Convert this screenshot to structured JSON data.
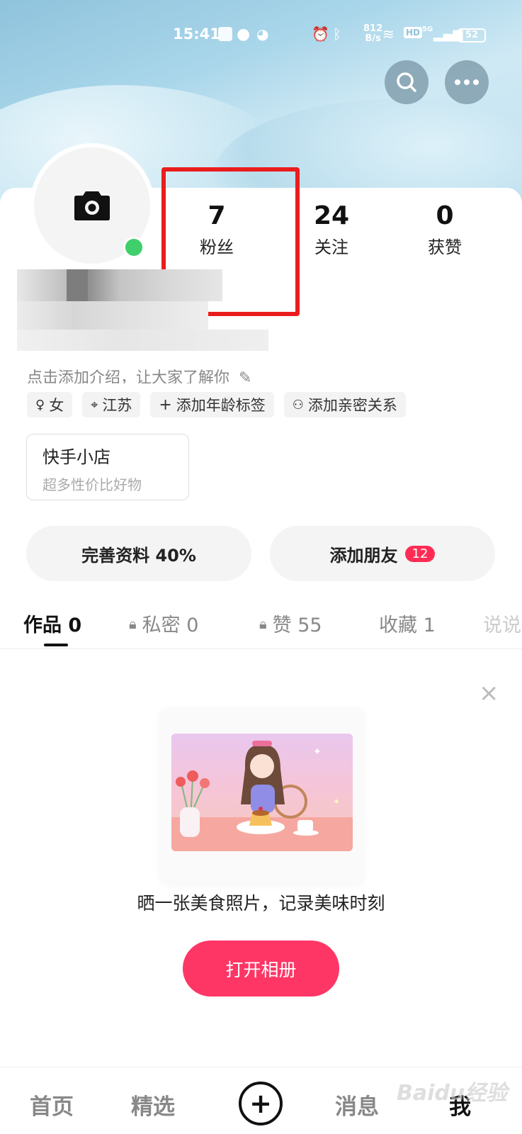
{
  "status_bar": {
    "time": "15:41",
    "net_speed_value": "812",
    "net_speed_unit": "B/s",
    "signal_text": "5G",
    "hd_text": "HD",
    "battery": "52"
  },
  "header": {
    "search_icon": "search-icon",
    "more_icon": "more-icon"
  },
  "profile": {
    "stats": [
      {
        "value": "7",
        "label": "粉丝"
      },
      {
        "value": "24",
        "label": "关注"
      },
      {
        "value": "0",
        "label": "获赞"
      }
    ],
    "intro": "点击添加介绍，让大家了解你",
    "tags": [
      {
        "icon": "gender-icon",
        "label": "女"
      },
      {
        "icon": "location-icon",
        "label": "江苏"
      },
      {
        "icon": "plus-icon",
        "label": "添加年龄标签"
      },
      {
        "icon": "person-icon",
        "label": "添加亲密关系"
      }
    ],
    "shop": {
      "title": "快手小店",
      "subtitle": "超多性价比好物"
    },
    "complete_profile": "完善资料 40%",
    "add_friends": "添加朋友",
    "add_friends_badge": "12"
  },
  "tabs": [
    {
      "label": "作品 0",
      "locked": false,
      "active": true
    },
    {
      "label": "私密 0",
      "locked": true,
      "active": false
    },
    {
      "label": "赞 55",
      "locked": true,
      "active": false
    },
    {
      "label": "收藏 1",
      "locked": false,
      "active": false
    },
    {
      "label": "说说",
      "locked": false,
      "active": false
    }
  ],
  "empty_state": {
    "caption": "晒一张美食照片，记录美味时刻",
    "button": "打开相册"
  },
  "bottom_nav": {
    "home": "首页",
    "featured": "精选",
    "plus": "+",
    "messages": "消息",
    "me": "我"
  },
  "watermark": "Baidu经验",
  "colors": {
    "accent": "#fe3666",
    "highlight": "#ea1d1d",
    "online": "#3fcf6b"
  }
}
